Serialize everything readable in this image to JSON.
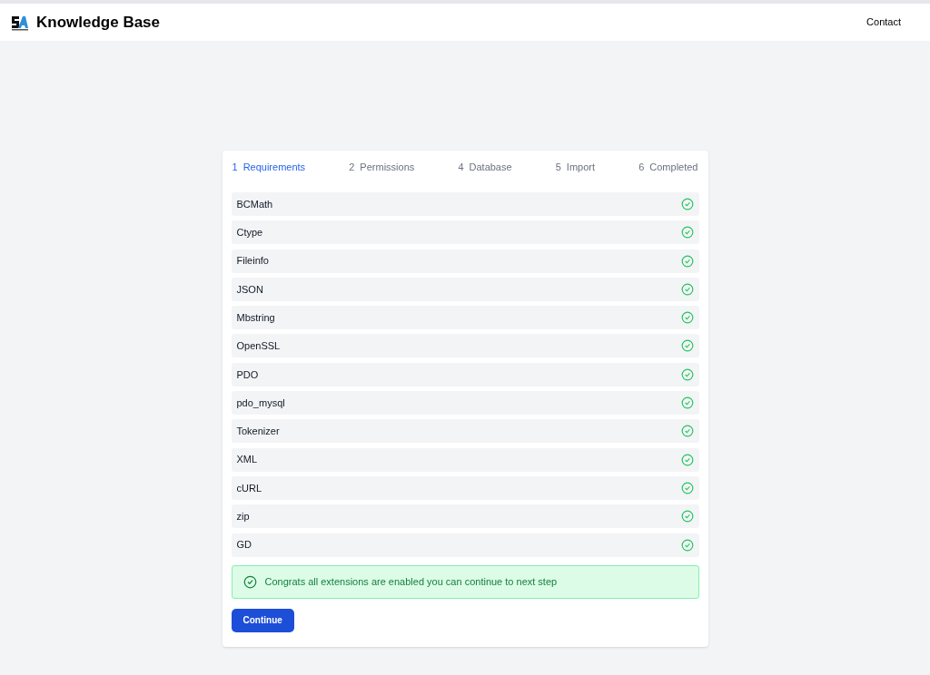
{
  "header": {
    "title": "Knowledge Base",
    "nav": [
      "Contact"
    ]
  },
  "steps": [
    {
      "number": "1",
      "label": "Requirements",
      "selected": true
    },
    {
      "number": "2",
      "label": "Permissions",
      "selected": false
    },
    {
      "number": "4",
      "label": "Database",
      "selected": false
    },
    {
      "number": "5",
      "label": "Import",
      "selected": false
    },
    {
      "number": "6",
      "label": "Completed",
      "selected": false
    }
  ],
  "extensions": [
    {
      "name": "BCMath",
      "enabled": true
    },
    {
      "name": "Ctype",
      "enabled": true
    },
    {
      "name": "Fileinfo",
      "enabled": true
    },
    {
      "name": "JSON",
      "enabled": true
    },
    {
      "name": "Mbstring",
      "enabled": true
    },
    {
      "name": "OpenSSL",
      "enabled": true
    },
    {
      "name": "PDO",
      "enabled": true
    },
    {
      "name": "pdo_mysql",
      "enabled": true
    },
    {
      "name": "Tokenizer",
      "enabled": true
    },
    {
      "name": "XML",
      "enabled": true
    },
    {
      "name": "cURL",
      "enabled": true
    },
    {
      "name": "zip",
      "enabled": true
    },
    {
      "name": "GD",
      "enabled": true
    }
  ],
  "alert": {
    "message": "Congrats all extensions are enabled you can continue to next step"
  },
  "button": "Continue"
}
